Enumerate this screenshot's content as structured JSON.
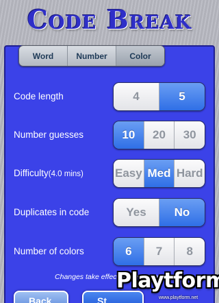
{
  "title": "Code Break",
  "tabs": [
    {
      "label": "Word",
      "active": false
    },
    {
      "label": "Number",
      "active": false
    },
    {
      "label": "Color",
      "active": true
    }
  ],
  "settings": [
    {
      "label": "Code length",
      "options": [
        "4",
        "5"
      ],
      "selected": "5"
    },
    {
      "label": "Number guesses",
      "options": [
        "10",
        "20",
        "30"
      ],
      "selected": "10"
    },
    {
      "label": "Difficulty",
      "label_extra": "(4.0 mins)",
      "options": [
        "Easy",
        "Med",
        "Hard"
      ],
      "selected": "Med"
    },
    {
      "label": "Duplicates in code",
      "options": [
        "Yes",
        "No"
      ],
      "selected": "No"
    },
    {
      "label": "Number of colors",
      "options": [
        "6",
        "7",
        "8"
      ],
      "selected": "6"
    }
  ],
  "note": "Changes take effect on next game",
  "buttons": {
    "back": "Back",
    "start": "St"
  },
  "watermark": {
    "logo": "Playtform",
    "url": "www.playtform.net"
  },
  "colors": {
    "panel": "#3b42e8",
    "selected": "#2f6fe6",
    "title": "#2f2fc8"
  }
}
